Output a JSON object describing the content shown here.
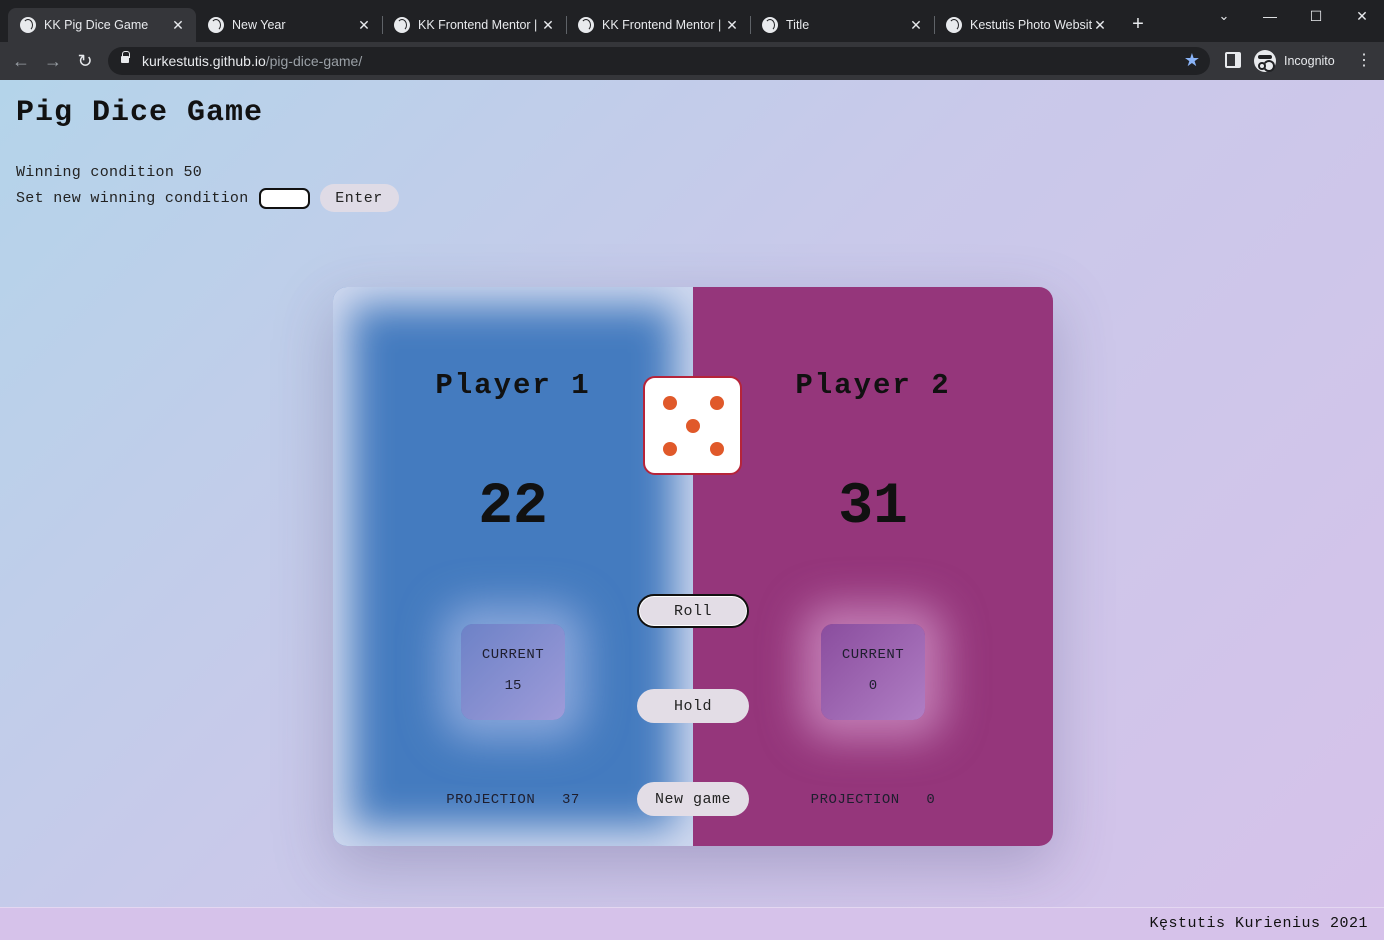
{
  "browser": {
    "tabs": [
      {
        "title": "KK Pig Dice Game",
        "active": true
      },
      {
        "title": "New Year",
        "active": false
      },
      {
        "title": "KK Frontend Mentor | F",
        "active": false
      },
      {
        "title": "KK Frontend Mentor | S",
        "active": false
      },
      {
        "title": "Title",
        "active": false
      },
      {
        "title": "Kestutis Photo Website",
        "active": false
      }
    ],
    "new_tab": "+",
    "url_host": "kurkestutis.github.io",
    "url_path": "/pig-dice-game/",
    "profile_label": "Incognito",
    "icons": {
      "back": "arrow-left-icon",
      "forward": "arrow-right-icon",
      "reload": "reload-icon",
      "bookmark": "star-icon",
      "extension": "side-panel-icon",
      "menu": "kebab-menu-icon"
    }
  },
  "game": {
    "title": "Pig Dice Game",
    "winning_condition_label": "Winning condition",
    "winning_condition_value": "50",
    "set_condition_label": "Set new winning condition",
    "set_condition_input_value": "",
    "enter_label": "Enter",
    "players": [
      {
        "name": "Player 1",
        "score": "22",
        "current_label": "CURRENT",
        "current": "15",
        "projection_label": "PROJECTION",
        "projection": "37"
      },
      {
        "name": "Player 2",
        "score": "31",
        "current_label": "CURRENT",
        "current": "0",
        "projection_label": "PROJECTION",
        "projection": "0"
      }
    ],
    "dice_value": 5,
    "buttons": {
      "roll": "Roll",
      "hold": "Hold",
      "new_game": "New game"
    },
    "colors": {
      "player1": "#447bbf",
      "player2": "#95367b",
      "dice_pip": "#e0592a",
      "dice_border": "#b6243a"
    }
  },
  "footer": {
    "text": "Kęstutis Kurienius 2021"
  }
}
